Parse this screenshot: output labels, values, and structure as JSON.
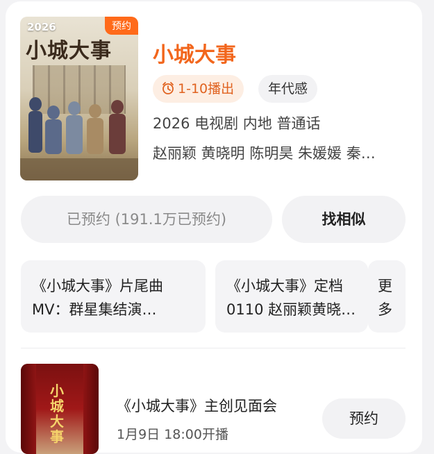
{
  "show": {
    "poster_year": "2026",
    "poster_title": "小城大事",
    "badge": "预约",
    "title": "小城大事",
    "air_time": "1-10播出",
    "genre_tag": "年代感",
    "meta": "2026 电视剧 内地 普通话",
    "cast": "赵丽颖 黄晓明 陈明昊 朱媛媛 秦…"
  },
  "actions": {
    "reserved_label": "已预约 (191.1万已预约)",
    "similar_label": "找相似"
  },
  "clips": [
    {
      "line1": "《小城大事》片尾曲",
      "line2": "MV：群星集结演…"
    },
    {
      "line1": "《小城大事》定档",
      "line2": "0110 赵丽颖黄晓…"
    }
  ],
  "more_label": {
    "line1": "更",
    "line2": "多"
  },
  "event": {
    "poster_title": "小城大事",
    "title": "《小城大事》主创见面会",
    "time": "1月9日 18:00开播",
    "button_label": "预约"
  },
  "colors": {
    "accent": "#f2661c",
    "tag_bg": "#fdeee3",
    "button_bg": "#f2f2f4"
  }
}
